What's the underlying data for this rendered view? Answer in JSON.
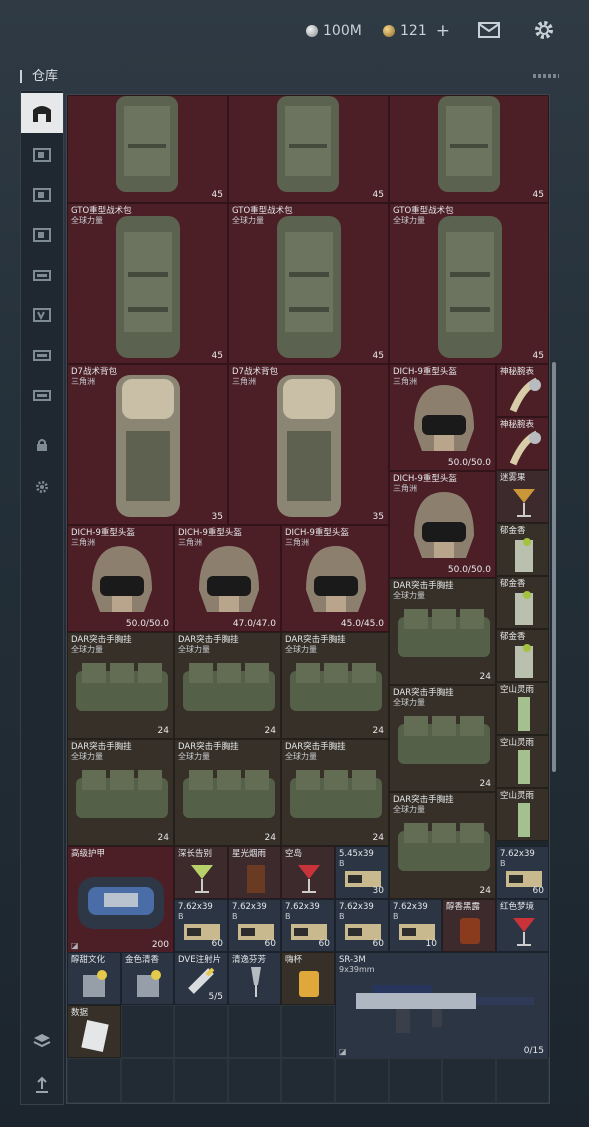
{
  "header": {
    "currency_silver": "100M",
    "currency_gold": "121",
    "plus_label": "+",
    "icons": [
      "mail-icon",
      "gear-icon"
    ]
  },
  "page_title": "仓库",
  "sidebar": {
    "items": [
      "warehouse-icon",
      "storage-tab-1-icon",
      "storage-tab-2-icon",
      "storage-tab-3-icon",
      "storage-tab-4-icon",
      "storage-tab-5-icon",
      "storage-tab-6-icon",
      "storage-tab-7-icon",
      "lock-icon",
      "settings-icon",
      "layers-icon",
      "sort-icon"
    ]
  },
  "items": {
    "gto_top_1": {
      "value": "45"
    },
    "gto_top_2": {
      "value": "45"
    },
    "gto_top_3": {
      "value": "45"
    },
    "gto_1": {
      "name": "GTO重型战术包",
      "sub": "全球力量",
      "value": "45"
    },
    "gto_2": {
      "name": "GTO重型战术包",
      "sub": "全球力量",
      "value": "45"
    },
    "gto_3": {
      "name": "GTO重型战术包",
      "sub": "全球力量",
      "value": "45"
    },
    "d7_1": {
      "name": "D7战术背包",
      "sub": "三角洲",
      "value": "35"
    },
    "d7_2": {
      "name": "D7战术背包",
      "sub": "三角洲",
      "value": "35"
    },
    "dich_r1": {
      "name": "DICH-9重型头盔",
      "sub": "三角洲",
      "value": "50.0/50.0"
    },
    "dich_r2": {
      "name": "DICH-9重型头盔",
      "sub": "三角洲",
      "value": "50.0/50.0"
    },
    "dich_a": {
      "name": "DICH-9重型头盔",
      "sub": "三角洲",
      "value": "50.0/50.0"
    },
    "dich_b": {
      "name": "DICH-9重型头盔",
      "sub": "三角洲",
      "value": "47.0/47.0"
    },
    "dich_c": {
      "name": "DICH-9重型头盔",
      "sub": "三角洲",
      "value": "45.0/45.0"
    },
    "watch_1": {
      "name": "神秘腕表"
    },
    "watch_2": {
      "name": "神秘腕表"
    },
    "drink_1": {
      "name": "迷雾果"
    },
    "drink_2": {
      "name": "郁金香"
    },
    "drink_3": {
      "name": "郁金香"
    },
    "drink_4": {
      "name": "郁金香"
    },
    "drink_5": {
      "name": "空山灵雨"
    },
    "drink_6": {
      "name": "空山灵雨"
    },
    "drink_7": {
      "name": "空山灵雨"
    },
    "dar_1": {
      "name": "DAR突击手胸挂",
      "sub": "全球力量",
      "value": "24"
    },
    "dar_2": {
      "name": "DAR突击手胸挂",
      "sub": "全球力量",
      "value": "24"
    },
    "dar_3": {
      "name": "DAR突击手胸挂",
      "sub": "全球力量",
      "value": "24"
    },
    "dar_4": {
      "name": "DAR突击手胸挂",
      "sub": "全球力量",
      "value": "24"
    },
    "dar_5": {
      "name": "DAR突击手胸挂",
      "sub": "全球力量",
      "value": "24"
    },
    "dar_6": {
      "name": "DAR突击手胸挂",
      "sub": "全球力量",
      "value": "24"
    },
    "dar_7": {
      "name": "DAR突击手胸挂",
      "sub": "全球力量",
      "value": "24"
    },
    "dar_8": {
      "name": "DAR突击手胸挂",
      "sub": "全球力量",
      "value": "24"
    },
    "dar_9": {
      "name": "DAR突击手胸挂",
      "sub": "全球力量",
      "value": "24"
    },
    "armor": {
      "name": "高级护甲",
      "value": "200"
    },
    "c1": {
      "name": "深长告别"
    },
    "c2": {
      "name": "星光烟雨"
    },
    "c3": {
      "name": "空岛"
    },
    "ammo_545": {
      "name": "5.45x39",
      "sub": "B",
      "value": "30"
    },
    "ammo_762_a": {
      "name": "7.62x39",
      "sub": "B",
      "value": "60"
    },
    "ammo_762_b": {
      "name": "7.62x39",
      "sub": "B",
      "value": "60"
    },
    "ammo_762_c": {
      "name": "7.62x39",
      "sub": "B",
      "value": "60"
    },
    "ammo_762_d": {
      "name": "7.62x39",
      "sub": "B",
      "value": "60"
    },
    "ammo_762_e": {
      "name": "7.62x39",
      "sub": "B",
      "value": "60"
    },
    "ammo_762_f": {
      "name": "7.62x39",
      "sub": "B",
      "value": "10"
    },
    "drink_r1": {
      "name": "醇香黑露"
    },
    "drink_r2": {
      "name": "红色梦境"
    },
    "b1": {
      "name": "醇甜文化"
    },
    "b2": {
      "name": "金色清香"
    },
    "b3": {
      "name": "DVE注射片",
      "value": "5/5"
    },
    "b4": {
      "name": "清逸芬芳"
    },
    "b5": {
      "name": "嗨杯"
    },
    "rifle": {
      "name": "SR-3M",
      "sub": "9x39mm",
      "value": "0/15"
    },
    "data": {
      "name": "数据"
    }
  }
}
